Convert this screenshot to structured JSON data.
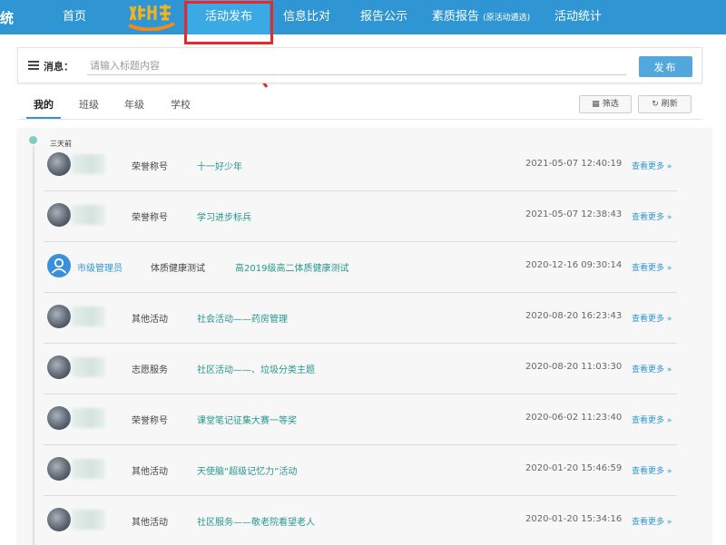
{
  "header": {
    "brand": "统",
    "nav": [
      {
        "label": "首页"
      },
      {
        "label": "活动发布"
      },
      {
        "label": "信息比对"
      },
      {
        "label": "报告公示"
      },
      {
        "label": "素质报告",
        "sub": "(原活动遴选)"
      },
      {
        "label": "活动统计"
      }
    ]
  },
  "composer": {
    "label": "消息：",
    "placeholder": "请输入标题内容",
    "publish": "发布"
  },
  "tabs": [
    {
      "label": "我的",
      "active": true
    },
    {
      "label": "班级"
    },
    {
      "label": "年级"
    },
    {
      "label": "学校"
    }
  ],
  "toolbar": {
    "filter": "筛选",
    "refresh": "刷新"
  },
  "feed": {
    "time_label": "三天前",
    "more_label": "查看更多",
    "items": [
      {
        "category": "荣誉称号",
        "title": "十一好少年",
        "time": "2021-05-07 12:40:19"
      },
      {
        "category": "荣誉称号",
        "title": "学习进步标兵",
        "time": "2021-05-07 12:38:43"
      },
      {
        "author": "市级管理员",
        "category": "体质健康测试",
        "title": "高2019级高二体质健康测试",
        "time": "2020-12-16 09:30:14"
      },
      {
        "category": "其他活动",
        "title": "社会活动——药房管理",
        "time": "2020-08-20 16:23:43"
      },
      {
        "category": "志愿服务",
        "title": "社区活动——、垃圾分类主题",
        "time": "2020-08-20 11:03:30"
      },
      {
        "category": "荣誉称号",
        "title": "课堂笔记征集大赛一等奖",
        "time": "2020-06-02 11:23:40"
      },
      {
        "category": "其他活动",
        "title": "天使脑“超级记忆力”活动",
        "time": "2020-01-20 15:46:59"
      },
      {
        "category": "其他活动",
        "title": "社区服务——敬老院看望老人",
        "time": "2020-01-20 15:34:16"
      }
    ]
  },
  "colors": {
    "topbar": "#2f96d3",
    "active_tab": "#3aa9e4",
    "highlight": "#e8282a",
    "title_text": "#27978e",
    "link": "#2f96d3"
  }
}
